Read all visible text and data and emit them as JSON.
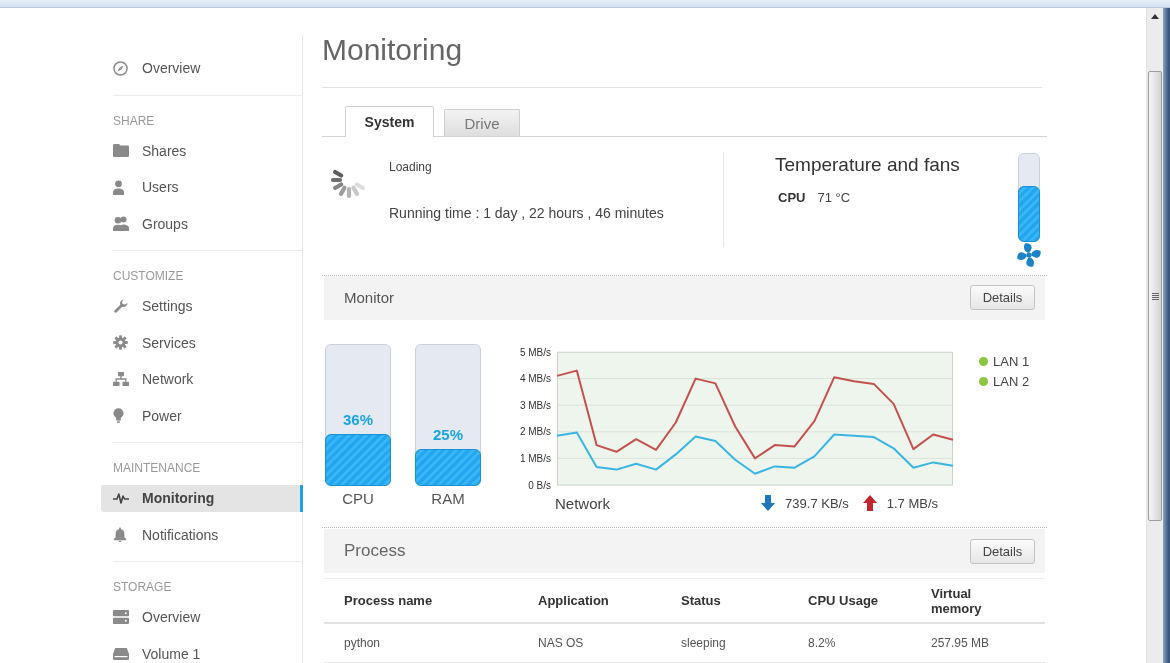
{
  "sidebar": {
    "sections": [
      {
        "items": [
          {
            "label": "Overview",
            "selected": false
          }
        ]
      },
      {
        "heading": "SHARE",
        "items": [
          {
            "label": "Shares",
            "selected": false
          },
          {
            "label": "Users",
            "selected": false
          },
          {
            "label": "Groups",
            "selected": false
          }
        ]
      },
      {
        "heading": "CUSTOMIZE",
        "items": [
          {
            "label": "Settings",
            "selected": false
          },
          {
            "label": "Services",
            "selected": false
          },
          {
            "label": "Network",
            "selected": false
          },
          {
            "label": "Power",
            "selected": false
          }
        ]
      },
      {
        "heading": "MAINTENANCE",
        "items": [
          {
            "label": "Monitoring",
            "selected": true
          },
          {
            "label": "Notifications",
            "selected": false
          }
        ]
      },
      {
        "heading": "STORAGE",
        "items": [
          {
            "label": "Overview",
            "selected": false
          },
          {
            "label": "Volume 1",
            "selected": false
          }
        ]
      }
    ]
  },
  "page": {
    "title": "Monitoring"
  },
  "tabs": [
    {
      "label": "System",
      "selected": true
    },
    {
      "label": "Drive",
      "selected": false
    }
  ],
  "system": {
    "status": "Loading",
    "running_time": "Running time : 1 day , 22 hours , 46 minutes"
  },
  "temperature": {
    "title": "Temperature and fans",
    "readings": [
      {
        "label": "CPU",
        "value": "71 °C"
      }
    ],
    "level": 0.62
  },
  "monitor": {
    "title": "Monitor",
    "button": "Details",
    "gauges": [
      {
        "label": "CPU",
        "value": "36%",
        "level": 0.36
      },
      {
        "label": "RAM",
        "value": "25%",
        "level": 0.25
      }
    ],
    "network": {
      "chart_data": {
        "type": "line",
        "xlabel": "Network",
        "grid": true,
        "ylim": [
          0,
          5
        ],
        "yticks": [
          {
            "value": 0,
            "label": "0 B/s"
          },
          {
            "value": 1,
            "label": "1 MB/s"
          },
          {
            "value": 2,
            "label": "2 MB/s"
          },
          {
            "value": 3,
            "label": "3 MB/s"
          },
          {
            "value": 4,
            "label": "4 MB/s"
          },
          {
            "value": 5,
            "label": "5 MB/s"
          }
        ],
        "series": [
          {
            "color": "#c4514f",
            "values": [
              4.1,
              4.3,
              1.5,
              1.25,
              1.72,
              1.32,
              2.35,
              4.0,
              3.82,
              2.2,
              1.0,
              1.5,
              1.45,
              2.4,
              4.05,
              3.9,
              3.8,
              3.05,
              1.35,
              1.9,
              1.7
            ]
          },
          {
            "color": "#3ab5e2",
            "values": [
              1.85,
              1.97,
              0.68,
              0.58,
              0.8,
              0.58,
              1.15,
              1.82,
              1.65,
              0.95,
              0.42,
              0.7,
              0.65,
              1.08,
              1.9,
              1.85,
              1.8,
              1.38,
              0.65,
              0.85,
              0.72
            ]
          }
        ]
      },
      "rates": [
        {
          "kind": "download",
          "value": "739.7 KB/s"
        },
        {
          "kind": "upload",
          "value": "1.7 MB/s"
        }
      ]
    },
    "legend": [
      {
        "label": "LAN 1"
      },
      {
        "label": "LAN 2"
      }
    ]
  },
  "process": {
    "title": "Process",
    "button": "Details",
    "columns": [
      "Process name",
      "Application",
      "Status",
      "CPU Usage",
      "Virtual memory"
    ],
    "rows": [
      [
        "python",
        "NAS OS",
        "sleeping",
        "8.2%",
        "257.95 MB"
      ]
    ]
  }
}
